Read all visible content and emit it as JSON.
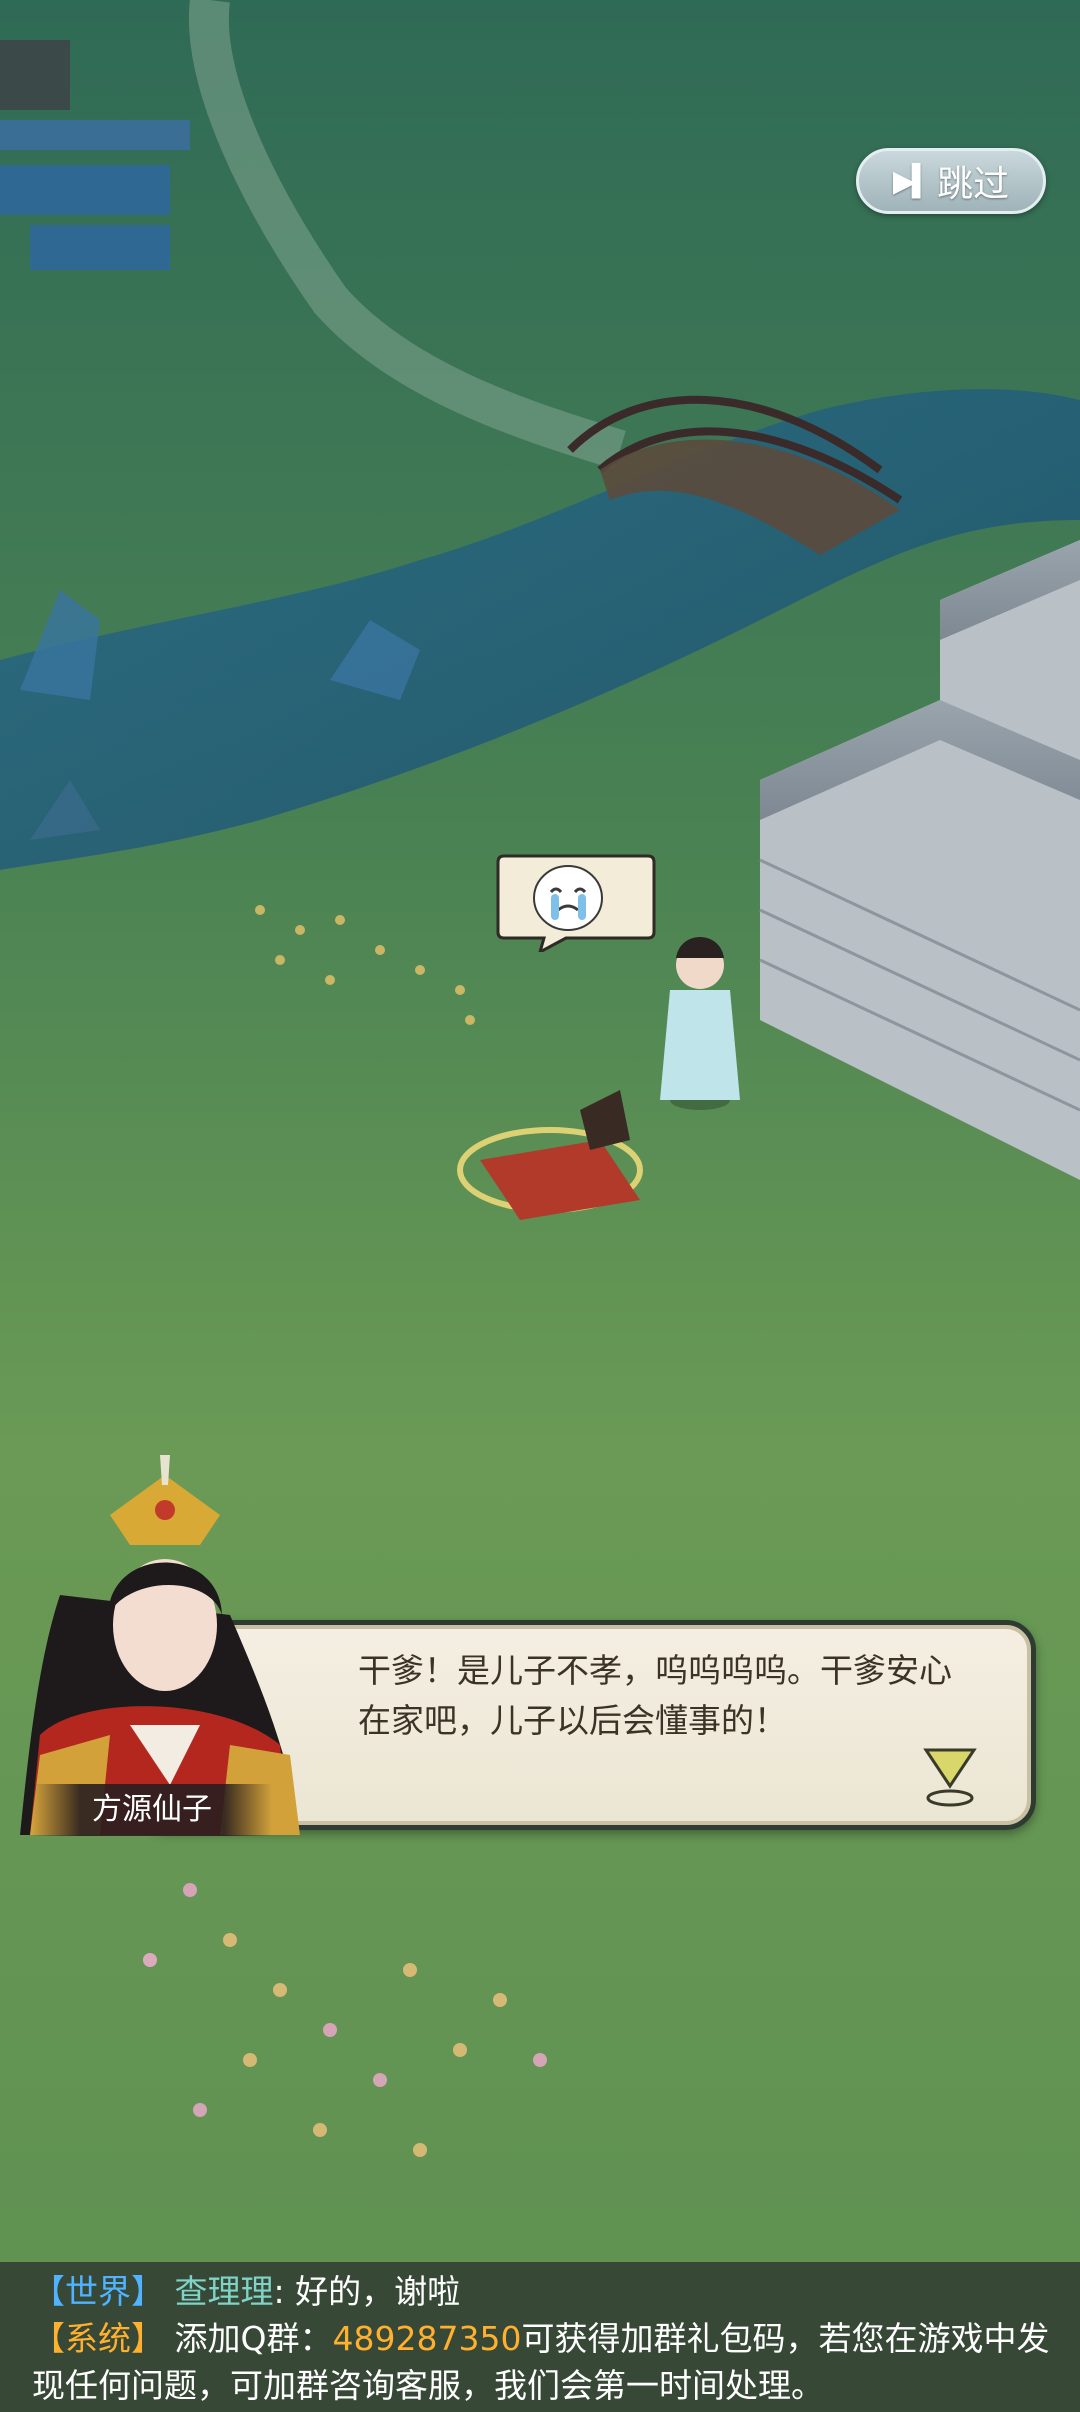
{
  "skip_button": {
    "label": "跳过",
    "icon": "skip-forward-icon"
  },
  "emote": {
    "icon": "crying-face-icon"
  },
  "dialog": {
    "speaker": "方源仙子",
    "text": "干爹！是儿子不孝，呜呜呜呜。干爹安心在家吧，儿子以后会懂事的！",
    "next_icon": "next-arrow-icon"
  },
  "chat": {
    "world": {
      "channel": "【世界】",
      "name": "查理理",
      "message": ": 好的，谢啦"
    },
    "system": {
      "channel": "【系统】",
      "prefix": "添加Q群：",
      "qq": "489287350",
      "suffix_line1": "可获得加群礼包码，若您在游戏中发",
      "line2": "现任何问题，可加群咨询客服，我们会第一时间处理。"
    }
  },
  "colors": {
    "world_channel": "#4fb3ff",
    "system_channel": "#ffb02e",
    "grass": "#5f8f4f",
    "river": "#1f5f78"
  }
}
